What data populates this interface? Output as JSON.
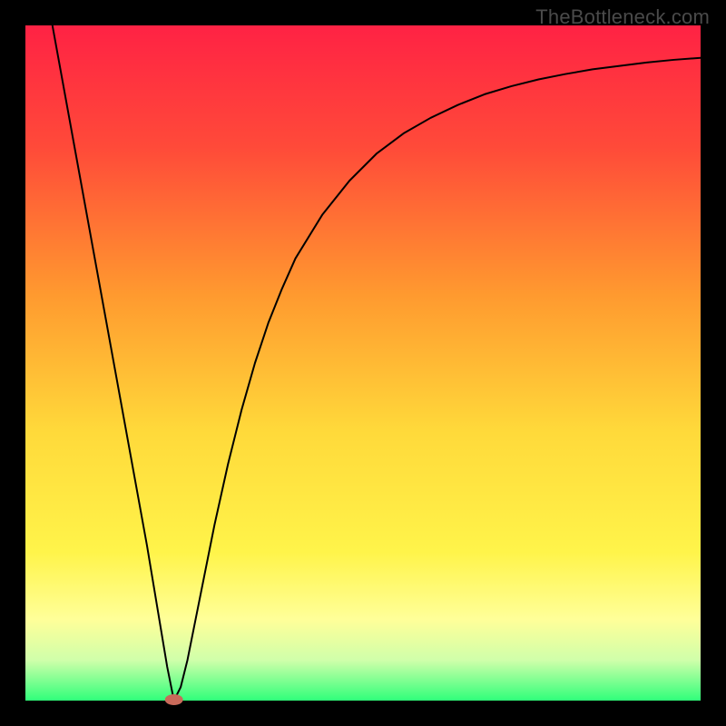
{
  "watermark": "TheBottleneck.com",
  "chart_data": {
    "type": "line",
    "title": "",
    "xlabel": "",
    "ylabel": "",
    "xlim": [
      0,
      100
    ],
    "ylim": [
      0,
      100
    ],
    "background": {
      "type": "vertical-gradient",
      "stops": [
        {
          "offset": 0.0,
          "color": "#ff2244"
        },
        {
          "offset": 0.18,
          "color": "#ff4a39"
        },
        {
          "offset": 0.4,
          "color": "#ff9a2f"
        },
        {
          "offset": 0.6,
          "color": "#ffd93a"
        },
        {
          "offset": 0.78,
          "color": "#fff44a"
        },
        {
          "offset": 0.88,
          "color": "#ffff99"
        },
        {
          "offset": 0.94,
          "color": "#d0ffaa"
        },
        {
          "offset": 1.0,
          "color": "#30ff7a"
        }
      ]
    },
    "border": {
      "color": "#000000",
      "thickness": 28
    },
    "minimum_marker": {
      "x": 22,
      "y": 0,
      "color": "#c96a5a",
      "rx": 10,
      "ry": 6
    },
    "series": [
      {
        "name": "bottleneck-curve",
        "color": "#000000",
        "stroke_width": 2,
        "x": [
          4,
          6,
          8,
          10,
          12,
          14,
          16,
          18,
          20,
          21,
          22,
          23,
          24,
          26,
          28,
          30,
          32,
          34,
          36,
          38,
          40,
          44,
          48,
          52,
          56,
          60,
          64,
          68,
          72,
          76,
          80,
          84,
          88,
          92,
          96,
          100
        ],
        "y": [
          100,
          89,
          78,
          67,
          56,
          45,
          34,
          23,
          11,
          5,
          0,
          2,
          6,
          16,
          26,
          35,
          43,
          50,
          56,
          61,
          65.5,
          72,
          77,
          81,
          84,
          86.3,
          88.2,
          89.8,
          91.0,
          92.0,
          92.8,
          93.5,
          94.0,
          94.5,
          94.9,
          95.2
        ]
      }
    ]
  }
}
